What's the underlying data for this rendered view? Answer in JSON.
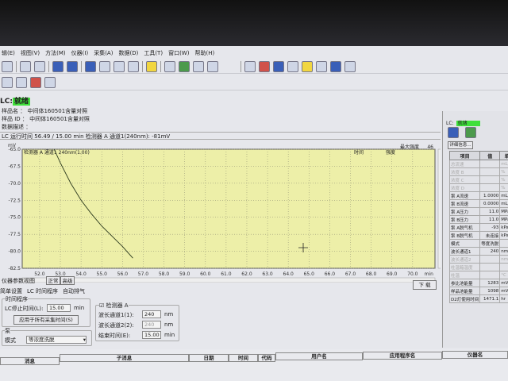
{
  "menu": [
    "辑(E)",
    "视图(V)",
    "方法(M)",
    "仪器(I)",
    "采集(A)",
    "数据(D)",
    "工具(T)",
    "窗口(W)",
    "帮助(H)"
  ],
  "status": {
    "prefix": "LC:",
    "state": "就绪",
    "color": "#3fe03a"
  },
  "info": {
    "sample_name": "样品名 ： 中间体160501含量对照",
    "sample_id": "样品 ID ： 中间体160501含量对照",
    "description": "数据描述 ："
  },
  "run_line": "LC 运行时间  56.49 / 15.00 min  检测器 A 通道1(240nm): -81mV",
  "chart_data": {
    "type": "line",
    "ylabel": "mV",
    "xlabel": "min",
    "series_label": "检测器 A 通道1 240nm(1.00)",
    "top_labels": {
      "max_intensity": "最大强度",
      "max_value": "46",
      "time": "时间",
      "intensity": "强度"
    },
    "xlim": [
      51.16,
      71.08
    ],
    "ylim": [
      -82.5,
      -65
    ],
    "xticks": [
      "52.0",
      "53.0",
      "54.0",
      "55.0",
      "56.0",
      "57.0",
      "58.0",
      "59.0",
      "60.0",
      "61.0",
      "62.0",
      "63.0",
      "64.0",
      "65.0",
      "66.0",
      "67.0",
      "68.0",
      "69.0",
      "70.0"
    ],
    "yticks": [
      "-65.0",
      "-67.5",
      "-70.0",
      "-72.5",
      "-75.0",
      "-77.5",
      "-80.0",
      "-82.5"
    ],
    "x": [
      52.7,
      53.0,
      53.5,
      54.0,
      54.5,
      55.0,
      55.5,
      56.0,
      56.5
    ],
    "y": [
      -65.0,
      -67.0,
      -70.0,
      -72.5,
      -74.5,
      -76.3,
      -77.8,
      -79.3,
      -81.0
    ],
    "line_color": "#2c3a1e",
    "bg": "#edefa8"
  },
  "download_label": "下 载",
  "panel": {
    "view_tab": "仪器参数视图",
    "mode_tabs": [
      "正常",
      "高级"
    ],
    "tabs": [
      "简单设置",
      "LC 时间程序",
      "自动排气"
    ],
    "time_prog": {
      "title": "时间程序",
      "stop_label": "LC停止时间(L):",
      "stop_value": "15.00",
      "unit": "min",
      "apply": "应用于所有采集时间(S)"
    },
    "pump": {
      "title": "泵",
      "mode_label": "模式",
      "mode_value": "等浓度洗脱"
    },
    "detector": {
      "title": "检测器 A",
      "ch1_label": "波长通道1(1):",
      "ch1_value": "240",
      "ch2_label": "波长通道2(2):",
      "ch2_value": "240",
      "nm": "nm",
      "end_label": "结束时间(E):",
      "end_value": "15.00",
      "min": "min"
    }
  },
  "messages": {
    "headers": [
      "消息",
      "子消息",
      "日期",
      "时间",
      "代码",
      "用户名",
      "应用程序名",
      "仪器名"
    ]
  },
  "right": {
    "prefix": "LC:",
    "state": "就绪",
    "detail_btn": "详细信息...",
    "headers": [
      "项目",
      "值",
      "单位"
    ],
    "rows": [
      [
        "总流速",
        "",
        "mL/min",
        true
      ],
      [
        "浓度 B",
        "",
        "%",
        true
      ],
      [
        "浓度 C",
        "",
        "%",
        true
      ],
      [
        "浓度 D",
        "",
        "%",
        true
      ],
      [
        "泵 A流速",
        "1.0000",
        "mL/min",
        false
      ],
      [
        "泵 B流速",
        "0.0000",
        "mL/min",
        false
      ],
      [
        "泵 A压力",
        "11.0",
        "MPa",
        false
      ],
      [
        "泵 B压力",
        "11.0",
        "MPa",
        false
      ],
      [
        "泵 A脱气机",
        "-93",
        "kPa",
        false
      ],
      [
        "泵 B脱气机",
        "未连接",
        "kPa",
        false
      ],
      [
        "模式",
        "等度洗脱",
        "",
        false
      ],
      [
        "波长通道1",
        "240",
        "nm",
        false
      ],
      [
        "波长通道2",
        "",
        "nm",
        true
      ],
      [
        "柱温箱温度",
        "",
        "",
        true
      ],
      [
        "柱温",
        "",
        "°C",
        true
      ],
      [
        "参比池能量",
        "1283",
        "mV",
        false
      ],
      [
        "样品池能量",
        "1098",
        "mV",
        false
      ],
      [
        "D2灯使用时间",
        "1471.1",
        "hr",
        false
      ]
    ]
  }
}
